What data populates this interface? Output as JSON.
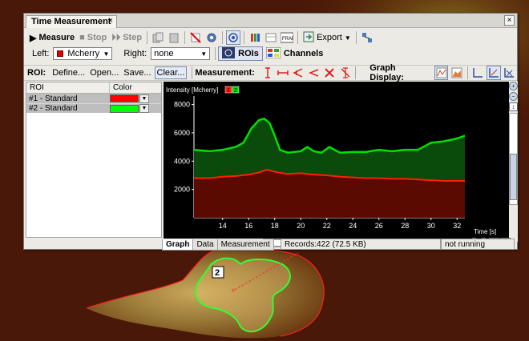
{
  "window": {
    "tab_title": "Time Measurement",
    "tab_close": "×",
    "close": "×"
  },
  "toolbar1": {
    "measure": "Measure",
    "stop": "Stop",
    "step": "Step",
    "export": "Export"
  },
  "toolbar2": {
    "left_label": "Left:",
    "left_value": "Mcherry",
    "right_label": "Right:",
    "right_value": "none",
    "rois": "ROIs",
    "channels": "Channels"
  },
  "toolbar3": {
    "roi_label": "ROI:",
    "define": "Define...",
    "open": "Open...",
    "save": "Save...",
    "clear": "Clear...",
    "measurement_label": "Measurement:",
    "graph_display_label": "Graph Display:"
  },
  "roi_table": {
    "headers": [
      "ROI",
      "Color"
    ],
    "rows": [
      {
        "name": "#1 - Standard",
        "color": "#ff0000"
      },
      {
        "name": "#2 - Standard",
        "color": "#00ff00"
      }
    ]
  },
  "bottom_tabs": [
    "Graph",
    "Data",
    "Measurement"
  ],
  "status": {
    "records": "Records:422 (72.5 KB)",
    "state": "not running"
  },
  "overlay": {
    "roi_number": "2"
  },
  "chart_data": {
    "type": "area",
    "ylabel": "Intensity [Mcherry]",
    "xlabel": "Time [s]",
    "xlim": [
      11.8,
      32.6
    ],
    "ylim": [
      0,
      8600
    ],
    "x_ticks": [
      14,
      16,
      18,
      20,
      22,
      24,
      26,
      28,
      30,
      32
    ],
    "y_ticks": [
      2000,
      4000,
      6000,
      8000
    ],
    "legend": [
      "1",
      "2"
    ],
    "grid": false,
    "series": [
      {
        "name": "1",
        "color": "#ff2000",
        "x": [
          11.8,
          13,
          14,
          15,
          16,
          16.8,
          17.4,
          18.2,
          19,
          20,
          21,
          22,
          23,
          24,
          25,
          26,
          27,
          28,
          29,
          30,
          31,
          32,
          32.6
        ],
        "y": [
          2800,
          2800,
          2900,
          2950,
          3050,
          3200,
          3400,
          3200,
          3100,
          3150,
          3050,
          3000,
          2900,
          2850,
          2800,
          2800,
          2750,
          2750,
          2700,
          2650,
          2600,
          2600,
          2600
        ]
      },
      {
        "name": "2",
        "color": "#00e000",
        "x": [
          11.8,
          13,
          14,
          15,
          15.6,
          16.2,
          16.8,
          17.2,
          17.6,
          18.0,
          18.4,
          19,
          20,
          20.5,
          21,
          21.6,
          22.2,
          23,
          24,
          25,
          26,
          27,
          28,
          29,
          30,
          31,
          32,
          32.6
        ],
        "y": [
          4800,
          4700,
          4800,
          5000,
          5300,
          6300,
          6900,
          7000,
          6700,
          5800,
          4800,
          4600,
          4700,
          5000,
          4700,
          4600,
          5000,
          4600,
          4650,
          4650,
          4800,
          4700,
          4800,
          4800,
          5300,
          5400,
          5600,
          5800
        ]
      }
    ]
  }
}
